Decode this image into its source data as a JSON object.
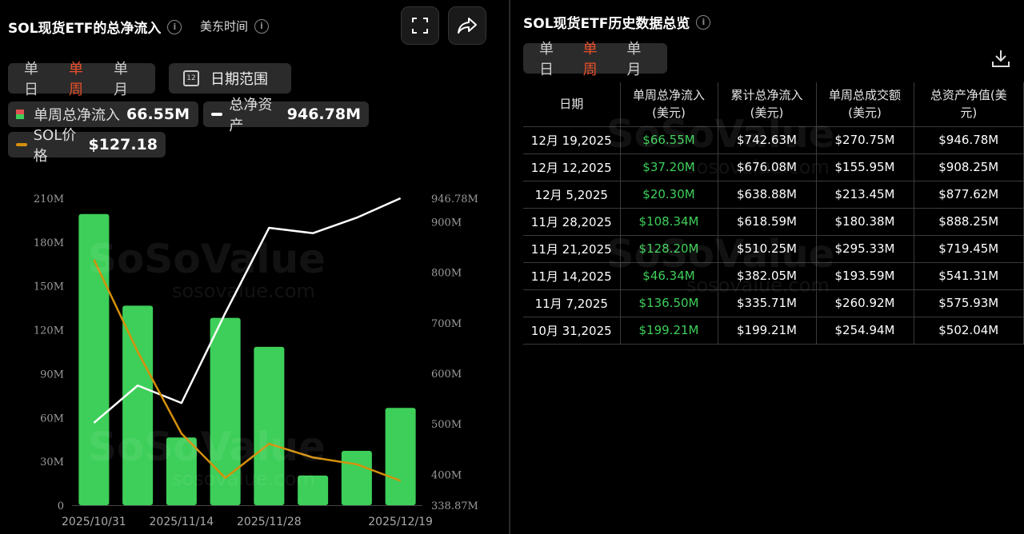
{
  "left": {
    "title": "SOL现货ETF的总净流入",
    "info": "i",
    "timezone": "美东时间",
    "tabs": [
      {
        "label": "单日",
        "active": false
      },
      {
        "label": "单周",
        "active": true
      },
      {
        "label": "单月",
        "active": false
      }
    ],
    "date_range_label": "日期范围",
    "calendar_day": "12",
    "legend": {
      "weekly_label": "单周总净流入",
      "weekly_value": "66.55M",
      "assets_label": "总净资产",
      "assets_value": "946.78M",
      "price_label": "SOL价格",
      "price_value": "$127.18"
    }
  },
  "right": {
    "title": "SOL现货ETF历史数据总览",
    "tabs": [
      {
        "label": "单日",
        "active": false
      },
      {
        "label": "单周",
        "active": true
      },
      {
        "label": "单月",
        "active": false
      }
    ],
    "table": {
      "headers": [
        "日期",
        "单周总净流入\n(美元)",
        "累计总净流入\n(美元)",
        "单周总成交额\n(美元)",
        "总资产净值(美\n元)"
      ],
      "rows": [
        [
          "12月 19,2025",
          "$66.55M",
          "$742.63M",
          "$270.75M",
          "$946.78M"
        ],
        [
          "12月 12,2025",
          "$37.20M",
          "$676.08M",
          "$155.95M",
          "$908.25M"
        ],
        [
          "12月 5,2025",
          "$20.30M",
          "$638.88M",
          "$213.45M",
          "$877.62M"
        ],
        [
          "11月 28,2025",
          "$108.34M",
          "$618.59M",
          "$180.38M",
          "$888.25M"
        ],
        [
          "11月 21,2025",
          "$128.20M",
          "$510.25M",
          "$295.33M",
          "$719.45M"
        ],
        [
          "11月 14,2025",
          "$46.34M",
          "$382.05M",
          "$193.59M",
          "$541.31M"
        ],
        [
          "11月 7,2025",
          "$136.50M",
          "$335.71M",
          "$260.92M",
          "$575.93M"
        ],
        [
          "10月 31,2025",
          "$199.21M",
          "$199.21M",
          "$254.94M",
          "$502.04M"
        ]
      ]
    }
  },
  "watermark": {
    "brand": "SoSoValue",
    "url": "sosovalue.com"
  },
  "colors": {
    "bar": "#3ecf5a",
    "assets_line": "#ffffff",
    "price_line": "#d4900a",
    "active_tab": "#e8502b",
    "positive": "#3ecf5a"
  },
  "chart_data": {
    "type": "bar",
    "x": [
      "2025/10/31",
      "2025/11/07",
      "2025/11/14",
      "2025/11/21",
      "2025/11/28",
      "2025/12/05",
      "2025/12/12",
      "2025/12/19"
    ],
    "x_tick_labels": [
      "2025/10/31",
      "2025/11/14",
      "2025/11/28",
      "2025/12/19"
    ],
    "x_tick_indices": [
      0,
      2,
      4,
      7
    ],
    "series": [
      {
        "name": "单周总净流入",
        "type": "bar",
        "axis": "left",
        "values": [
          199.21,
          136.5,
          46.34,
          128.2,
          108.34,
          20.3,
          37.2,
          66.55
        ]
      },
      {
        "name": "总净资产",
        "type": "line",
        "axis": "right",
        "values": [
          502.04,
          575.93,
          541.31,
          719.45,
          888.25,
          877.62,
          908.25,
          946.78
        ]
      },
      {
        "name": "SOL价格",
        "type": "line",
        "axis": "price",
        "values": [
          192,
          165,
          141,
          128,
          138,
          134,
          132,
          127.18
        ]
      }
    ],
    "left_axis": {
      "ticks": [
        "0",
        "30M",
        "60M",
        "90M",
        "120M",
        "150M",
        "180M",
        "210M"
      ],
      "range": [
        0,
        210
      ]
    },
    "right_axis": {
      "ticks": [
        "338.87M",
        "400M",
        "500M",
        "600M",
        "700M",
        "800M",
        "900M",
        "946.78M"
      ],
      "range": [
        338.87,
        946.78
      ]
    },
    "price_range": [
      120,
      210
    ],
    "grid": false
  }
}
